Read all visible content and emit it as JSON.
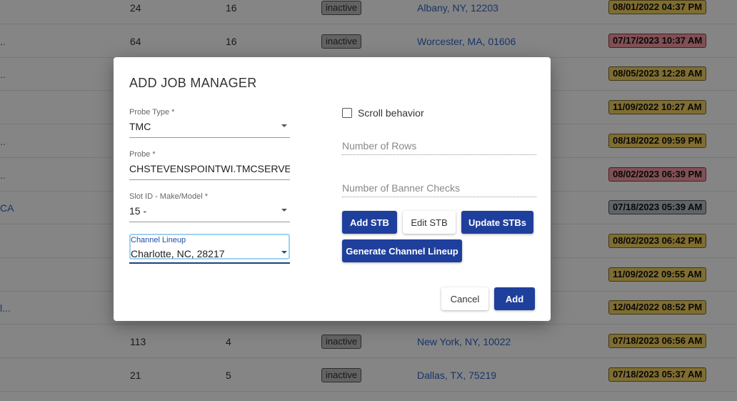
{
  "background_rows": [
    {
      "left": "",
      "a": "24",
      "b": "16",
      "status": "inactive",
      "location": "Albany, NY, 12203",
      "date": "08/01/2022 04:37 PM",
      "date_color": "yellow"
    },
    {
      "left": "..",
      "a": "64",
      "b": "16",
      "status": "inactive",
      "location": "Worcester, MA, 01606",
      "date": "07/17/2023 10:37 AM",
      "date_color": "red"
    },
    {
      "left": "..",
      "a": "",
      "b": "",
      "status": "",
      "location": "",
      "date": "08/05/2023 12:28 AM",
      "date_color": "yellow"
    },
    {
      "left": "",
      "a": "",
      "b": "",
      "status": "",
      "location": "",
      "date": "11/09/2022 10:27 AM",
      "date_color": "yellow"
    },
    {
      "left": "..",
      "a": "",
      "b": "",
      "status": "",
      "location": "",
      "date": "08/18/2022 09:59 PM",
      "date_color": "yellow"
    },
    {
      "left": "..",
      "a": "",
      "b": "",
      "status": "",
      "location": "",
      "date": "08/02/2023 06:39 PM",
      "date_color": "red"
    },
    {
      "left": "CA",
      "a": "",
      "b": "",
      "status": "",
      "location": "",
      "date": "07/18/2023 05:39 AM",
      "date_color": "gray"
    },
    {
      "left": "",
      "a": "",
      "b": "",
      "status": "",
      "location": "",
      "date": "08/02/2023 06:42 PM",
      "date_color": "yellow"
    },
    {
      "left": "",
      "a": "",
      "b": "",
      "status": "",
      "location": "",
      "date": "11/09/2022 09:55 AM",
      "date_color": "yellow"
    },
    {
      "left": "l...",
      "a": "",
      "b": "",
      "status": "",
      "location": "",
      "date": "12/04/2022 08:52 PM",
      "date_color": "yellow"
    },
    {
      "left": "",
      "a": "113",
      "b": "4",
      "status": "inactive",
      "location": "New York, NY, 10022",
      "date": "07/18/2023 06:56 AM",
      "date_color": "yellow"
    },
    {
      "left": "",
      "a": "21",
      "b": "5",
      "status": "inactive",
      "location": "Dallas, TX, 75219",
      "date": "07/18/2023 05:37 AM",
      "date_color": "yellow"
    }
  ],
  "modal": {
    "title": "ADD JOB MANAGER",
    "probe_type": {
      "label": "Probe Type *",
      "value": "TMC"
    },
    "probe": {
      "label": "Probe *",
      "value": "CHSTEVENSPOINTWI.TMCSERVER"
    },
    "slot": {
      "label": "Slot ID - Make/Model *",
      "value": "15 -"
    },
    "channel_lineup": {
      "label": "Channel Lineup",
      "value": "Charlotte, NC, 28217"
    },
    "scroll_behavior": "Scroll behavior",
    "rows_placeholder": "Number of Rows",
    "banner_placeholder": "Number of Banner Checks",
    "buttons": {
      "add_stb": "Add STB",
      "edit_stb": "Edit STB",
      "update_stbs": "Update STBs",
      "generate": "Generate Channel Lineup",
      "cancel": "Cancel",
      "add": "Add"
    }
  },
  "colors": {
    "primary": "#1f3f9c",
    "link": "#2f66c8",
    "date_yellow": "#f4d25f",
    "date_red": "#f59aa4",
    "date_gray": "#b9bec7"
  }
}
